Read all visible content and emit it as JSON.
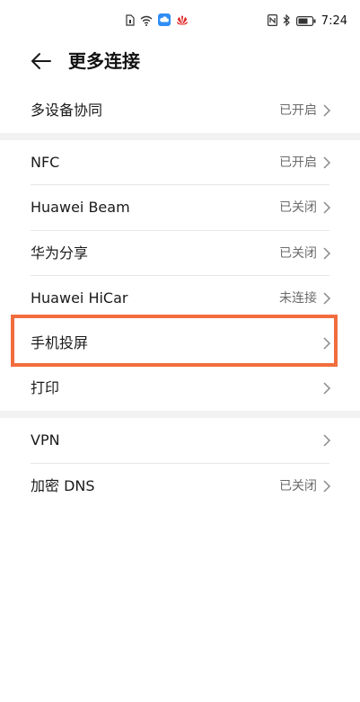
{
  "status": {
    "time": "7:24",
    "icons_center": [
      "sim-icon",
      "wifi-icon",
      "cloud-app-icon",
      "huawei-logo-icon"
    ],
    "icons_right": [
      "nfc-icon",
      "bluetooth-icon",
      "battery-icon"
    ]
  },
  "header": {
    "title": "更多连接"
  },
  "sections": [
    {
      "items": [
        {
          "label": "多设备协同",
          "value": "已开启"
        }
      ]
    },
    {
      "items": [
        {
          "label": "NFC",
          "value": "已开启"
        },
        {
          "label": "Huawei Beam",
          "value": "已关闭"
        },
        {
          "label": "华为分享",
          "value": "已关闭"
        },
        {
          "label": "Huawei HiCar",
          "value": "未连接"
        },
        {
          "label": "手机投屏",
          "value": ""
        },
        {
          "label": "打印",
          "value": ""
        }
      ]
    },
    {
      "items": [
        {
          "label": "VPN",
          "value": ""
        },
        {
          "label": "加密 DNS",
          "value": "已关闭"
        }
      ]
    }
  ],
  "colors": {
    "highlight": "#f26d3d",
    "value_text": "#6b6b6b",
    "divider": "#e6e6e6",
    "section_gap": "#f2f2f2"
  }
}
